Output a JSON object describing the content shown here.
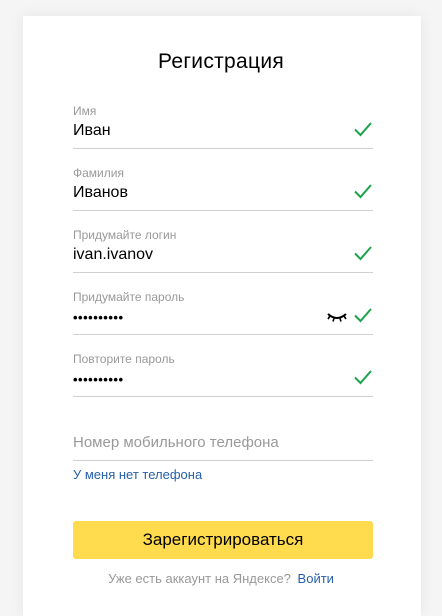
{
  "title": "Регистрация",
  "fields": [
    {
      "label": "Имя",
      "value": "Иван",
      "valid": true
    },
    {
      "label": "Фамилия",
      "value": "Иванов",
      "valid": true
    },
    {
      "label": "Придумайте логин",
      "value": "ivan.ivanov",
      "valid": true
    },
    {
      "label": "Придумайте пароль",
      "value": "••••••••••",
      "valid": true,
      "icon": "eye-closed-icon"
    },
    {
      "label": "Повторите пароль",
      "value": "••••••••••",
      "valid": true
    }
  ],
  "phone": {
    "placeholder": "Номер мобильного телефона",
    "no_phone_link": "У меня нет телефона"
  },
  "submit_label": "Зарегистрироваться",
  "footer": {
    "text": "Уже есть аккаунт на Яндексе?",
    "login_link": "Войти"
  },
  "colors": {
    "accent_button": "#ffdb4d",
    "link": "#2760aa",
    "check": "#1aa34a"
  }
}
